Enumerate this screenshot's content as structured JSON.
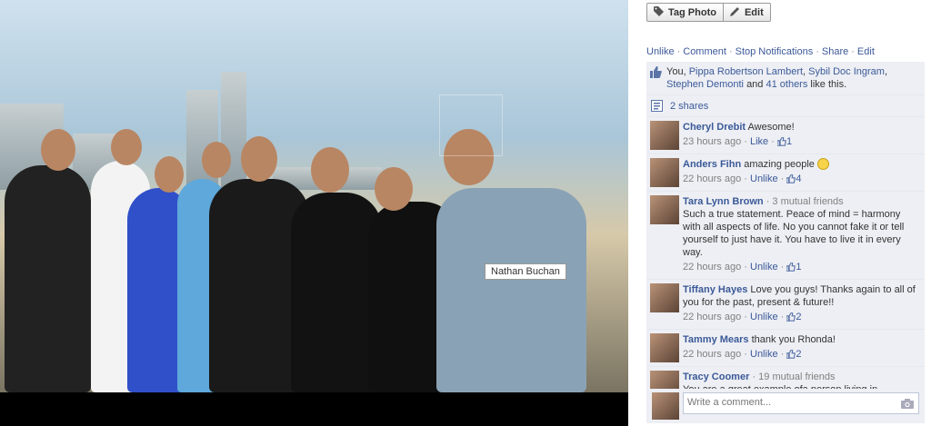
{
  "photo": {
    "tag_label": "Nathan Buchan"
  },
  "actions": {
    "tag_photo": "Tag Photo",
    "edit": "Edit"
  },
  "links": {
    "unlike": "Unlike",
    "comment": "Comment",
    "stop_notifications": "Stop Notifications",
    "share": "Share",
    "edit": "Edit"
  },
  "likes": {
    "you": "You,",
    "names": [
      "Pippa Robertson Lambert",
      "Sybil Doc Ingram",
      "Stephen Demonti"
    ],
    "and": "and",
    "others": "41 others",
    "suffix": "like this."
  },
  "shares": "2 shares",
  "comments": [
    {
      "name": "Cheryl Drebit",
      "mutual": "",
      "text": "Awesome!",
      "time": "23 hours ago",
      "action": "Like",
      "count": "1"
    },
    {
      "name": "Anders Fihn",
      "mutual": "",
      "text": "amazing people",
      "time": "22 hours ago",
      "action": "Unlike",
      "count": "4"
    },
    {
      "name": "Tara Lynn Brown",
      "mutual": "· 3 mutual friends",
      "text": "Such a true statement. Peace of mind = harmony with all aspects of life. No you cannot fake it or tell yourself to just have it. You have to live it in every way.",
      "time": "22 hours ago",
      "action": "Unlike",
      "count": "1"
    },
    {
      "name": "Tiffany Hayes",
      "mutual": "",
      "text": "Love you guys! Thanks again to all of you for the past, present & future!!",
      "time": "22 hours ago",
      "action": "Unlike",
      "count": "2"
    },
    {
      "name": "Tammy Mears",
      "mutual": "",
      "text": "thank you Rhonda!",
      "time": "22 hours ago",
      "action": "Unlike",
      "count": "2"
    },
    {
      "name": "Tracy Coomer",
      "mutual": "· 19 mutual friends",
      "text": "You are a great example ofa person living in harmony with true principles & values",
      "time": "",
      "action": "",
      "count": ""
    }
  ],
  "write_comment": {
    "placeholder": "Write a comment..."
  },
  "colors": {
    "link": "#3b5998",
    "panel_bg": "#edeff4"
  }
}
